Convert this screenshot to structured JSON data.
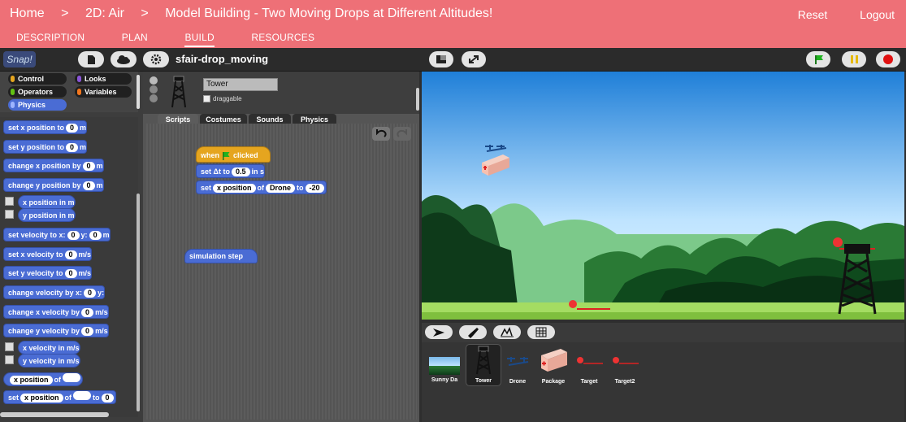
{
  "topbar": {
    "breadcrumbs": [
      "Home",
      "2D: Air",
      "Model Building - Two Moving Drops at Different Altitudes!"
    ],
    "separator": ">",
    "actions": [
      "Reset",
      "Logout"
    ],
    "tabs": [
      "DESCRIPTION",
      "PLAN",
      "BUILD",
      "RESOURCES"
    ],
    "active_tab": "BUILD"
  },
  "snap": {
    "logo_text": "Snap!",
    "project_name": "sfair-drop_moving"
  },
  "categories": [
    {
      "label": "Control",
      "color": "#e5a51f"
    },
    {
      "label": "Looks",
      "color": "#8a55d7"
    },
    {
      "label": "Operators",
      "color": "#62c213"
    },
    {
      "label": "Variables",
      "color": "#f3761d"
    },
    {
      "label": "Physics",
      "color": "#4a6cd4"
    }
  ],
  "palette": {
    "set_x": {
      "label": "set x position to",
      "value": "0",
      "unit": "m"
    },
    "set_y": {
      "label": "set y position to",
      "value": "0",
      "unit": "m"
    },
    "change_x": {
      "label": "change x position by",
      "value": "0",
      "unit": "m"
    },
    "change_y": {
      "label": "change y position by",
      "value": "0",
      "unit": "m"
    },
    "x_pos": "x position in m",
    "y_pos": "y position in m",
    "set_vel": {
      "label": "set velocity to x:",
      "x": "0",
      "y_label": "y:",
      "y": "0",
      "unit": "m"
    },
    "set_xvel": {
      "label": "set x velocity to",
      "value": "0",
      "unit": "m/s"
    },
    "set_yvel": {
      "label": "set y velocity to",
      "value": "0",
      "unit": "m/s"
    },
    "change_vel": {
      "label": "change velocity by x:",
      "x": "0",
      "y_label": "y:"
    },
    "change_xvel": {
      "label": "change x velocity by",
      "value": "0",
      "unit": "m/s"
    },
    "change_yvel": {
      "label": "change y velocity by",
      "value": "0",
      "unit": "m/s"
    },
    "x_vel": "x velocity in m/s",
    "y_vel": "y velocity in m/s",
    "of_block": {
      "attr": "x position",
      "of": "of"
    },
    "set_of": {
      "set": "set",
      "attr": "x position",
      "of": "of",
      "to": "to",
      "value": "0"
    }
  },
  "sprite": {
    "name": "Tower",
    "draggable_label": "draggable",
    "tabs": [
      "Scripts",
      "Costumes",
      "Sounds",
      "Physics"
    ],
    "active_tab": "Scripts"
  },
  "scripts": {
    "hat": {
      "when": "when",
      "clicked": "clicked"
    },
    "set_dt": {
      "set": "set",
      "label": "Δt to",
      "value": "0.5",
      "unit": "in s"
    },
    "set_prop": {
      "set": "set",
      "attr": "x position",
      "of": "of",
      "target": "Drone",
      "to": "to",
      "value": "-20"
    },
    "sim_step": "simulation step"
  },
  "corral": {
    "sprites": [
      {
        "label": "Sunny Da"
      },
      {
        "label": "Tower"
      },
      {
        "label": "Drone"
      },
      {
        "label": "Package"
      },
      {
        "label": "Target"
      },
      {
        "label": "Target2"
      }
    ]
  },
  "colors": {
    "header": "#ee7077",
    "motion_blue": "#4a6cd4",
    "control_orange": "#e5a51f",
    "sky_top": "#1f7fd8",
    "jungle": "#1f6b2a"
  }
}
